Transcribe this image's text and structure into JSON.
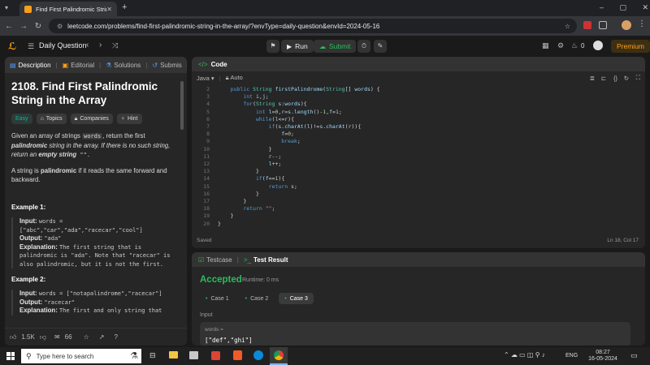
{
  "browser": {
    "tab_title": "Find First Palindromic String in",
    "url": "leetcode.com/problems/find-first-palindromic-string-in-the-array/?envType=daily-question&envId=2024-05-16",
    "window_controls": [
      "–",
      "▢",
      "✕"
    ]
  },
  "header": {
    "daily_question": "Daily Question",
    "run": "Run",
    "submit": "Submit",
    "fire_count": "0",
    "premium": "Premium"
  },
  "left": {
    "tabs": [
      "Description",
      "Editorial",
      "Solutions",
      "Submis"
    ],
    "title": "2108. Find First Palindromic String in the Array",
    "tags": [
      "Easy",
      "Topics",
      "Companies",
      "Hint"
    ],
    "desc1_a": "Given an array of strings ",
    "desc1_code": "words",
    "desc1_b": ", return the first ",
    "desc1_c": "palindromic",
    "desc1_d": " string in the array. If there is no such string, return an ",
    "desc1_e": "empty string",
    "desc1_f": " \"\".",
    "desc2_a": "A string is ",
    "desc2_b": "palindromic",
    "desc2_c": " if it reads the same forward and backward.",
    "ex1_title": "Example 1:",
    "ex1_input_label": "Input:",
    "ex1_input": "words = [\"abc\",\"car\",\"ada\",\"racecar\",\"cool\"]",
    "ex1_output_label": "Output:",
    "ex1_output": "\"ada\"",
    "ex1_expl_label": "Explanation:",
    "ex1_expl": "The first string that is palindromic is \"ada\". Note that \"racecar\" is also palindromic, but it is not the first.",
    "ex2_title": "Example 2:",
    "ex2_input_label": "Input:",
    "ex2_input": "words = [\"notapalindrome\",\"racecar\"]",
    "ex2_output_label": "Output:",
    "ex2_output": "\"racecar\"",
    "ex2_expl_label": "Explanation:",
    "ex2_expl": "The first and only string that",
    "likes": "1.5K",
    "comments": "66"
  },
  "code": {
    "tab_label": "Code",
    "language": "Java",
    "mode": "Auto",
    "saved": "Saved",
    "cursor": "Ln 18, Col 17",
    "lines": [
      {
        "n": "2",
        "text": "    public String firstPalindrome(String[] words) {"
      },
      {
        "n": "3",
        "text": "        int i,j;"
      },
      {
        "n": "4",
        "text": "        for(String s:words){"
      },
      {
        "n": "5",
        "text": "            int l=0,r=s.length()-1,f=1;"
      },
      {
        "n": "6",
        "text": "            while(l<=r){"
      },
      {
        "n": "7",
        "text": "                if(s.charAt(l)!=s.charAt(r)){"
      },
      {
        "n": "8",
        "text": "                    f=0;"
      },
      {
        "n": "9",
        "text": "                    break;"
      },
      {
        "n": "10",
        "text": "                }"
      },
      {
        "n": "11",
        "text": "                r--;"
      },
      {
        "n": "12",
        "text": "                l++;"
      },
      {
        "n": "13",
        "text": "            }"
      },
      {
        "n": "14",
        "text": "            if(f==1){"
      },
      {
        "n": "15",
        "text": "                return s;"
      },
      {
        "n": "16",
        "text": "            }"
      },
      {
        "n": "17",
        "text": "        }"
      },
      {
        "n": "18",
        "text": "        return \"\";"
      },
      {
        "n": "19",
        "text": "    }"
      },
      {
        "n": "20",
        "text": "}"
      }
    ]
  },
  "result": {
    "testcase_tab": "Testcase",
    "result_tab": "Test Result",
    "status": "Accepted",
    "runtime": "Runtime: 0 ms",
    "cases": [
      "Case 1",
      "Case 2",
      "Case 3"
    ],
    "input_label": "Input",
    "var_label": "words =",
    "var_value": "[\"def\",\"ghi\"]"
  },
  "taskbar": {
    "search_placeholder": "Type here to search",
    "lang": "ENG",
    "time": "08:27",
    "date": "16-05-2024"
  },
  "colors": {
    "accent_green": "#2cbb5d",
    "easy": "#00b8a3",
    "premium": "#ffa116"
  }
}
